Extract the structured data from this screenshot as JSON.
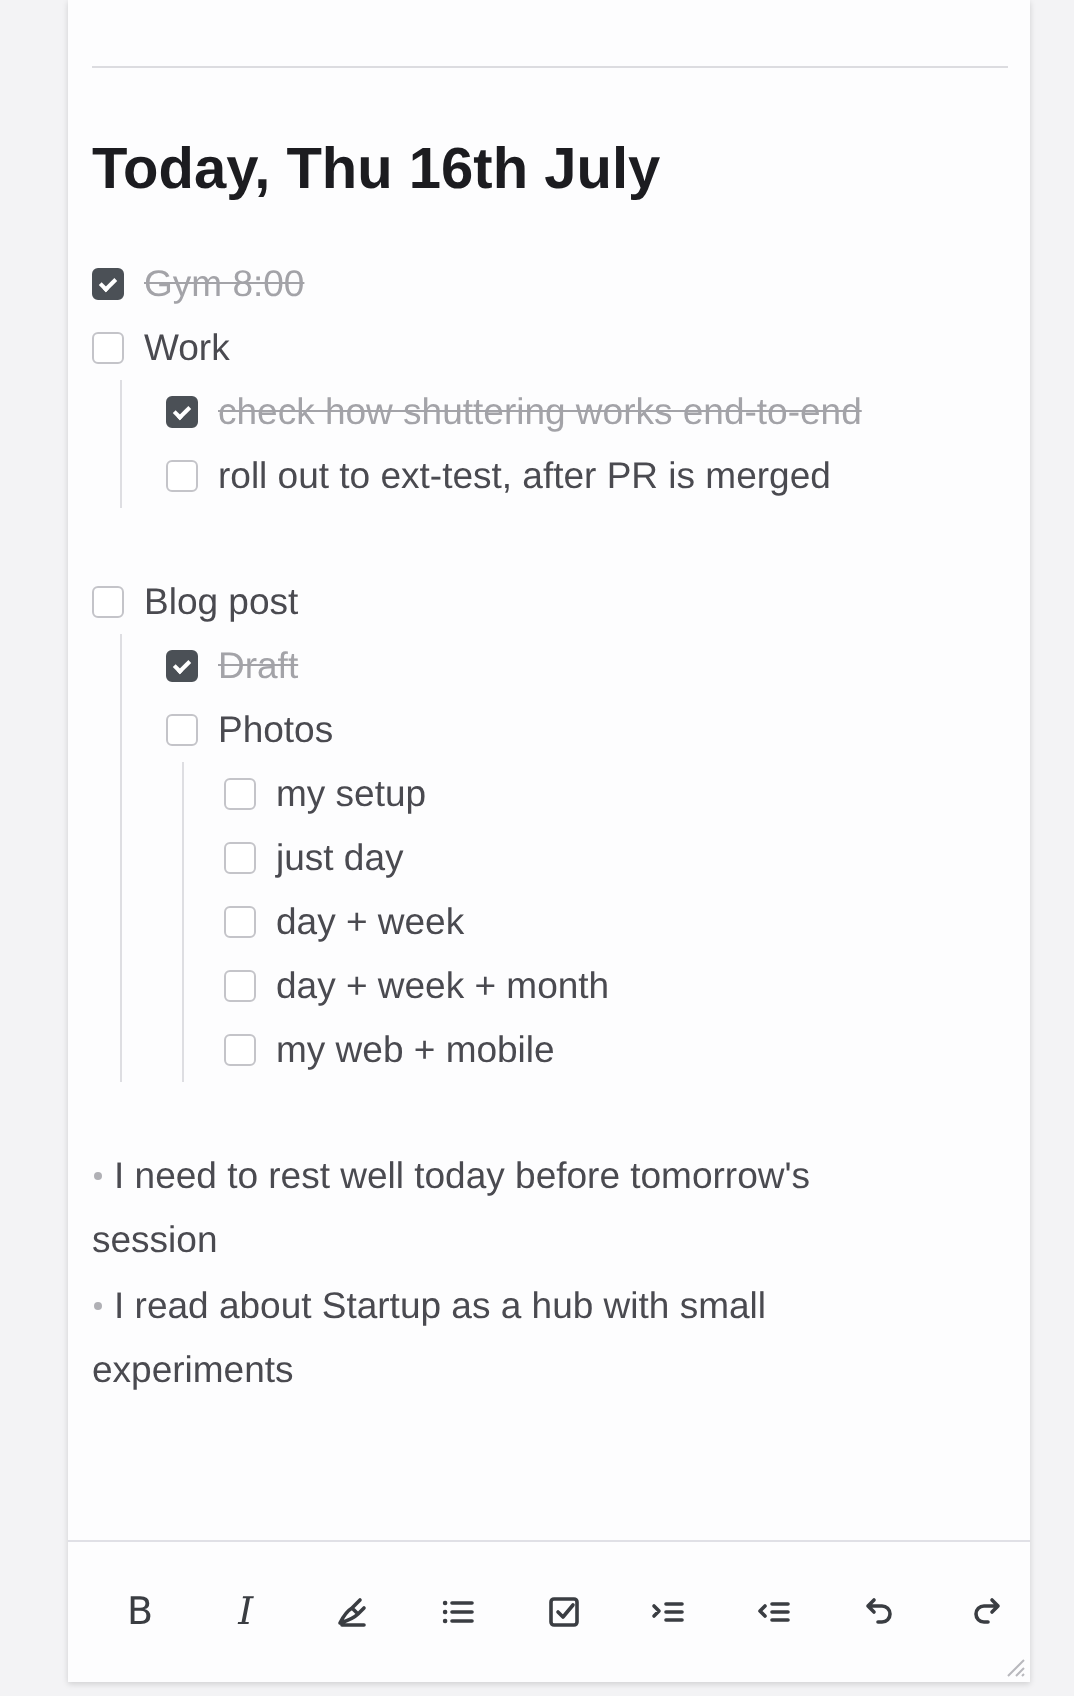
{
  "heading": "Today, Thu 16th July",
  "todo_groups": [
    [
      {
        "text": "Gym 8:00",
        "checked": true
      },
      {
        "text": "Work",
        "checked": false,
        "children": [
          {
            "text": "check how shuttering works end-to-end",
            "checked": true
          },
          {
            "text": "roll out to ext-test, after PR is merged",
            "checked": false
          }
        ]
      }
    ],
    [
      {
        "text": "Blog post",
        "checked": false,
        "children": [
          {
            "text": "Draft",
            "checked": true
          },
          {
            "text": "Photos",
            "checked": false,
            "children": [
              {
                "text": "my setup",
                "checked": false
              },
              {
                "text": "just day",
                "checked": false
              },
              {
                "text": "day + week",
                "checked": false
              },
              {
                "text": "day + week + month",
                "checked": false
              },
              {
                "text": "my web + mobile",
                "checked": false
              }
            ]
          }
        ]
      }
    ]
  ],
  "notes": [
    "I need to rest well today before tomorrow's session",
    "I read about Startup as a hub with small experiments"
  ],
  "toolbar": [
    {
      "kind": "bold",
      "label": "B"
    },
    {
      "kind": "italic",
      "label": "I"
    },
    {
      "kind": "highlight"
    },
    {
      "kind": "bullet-list"
    },
    {
      "kind": "checklist"
    },
    {
      "kind": "indent"
    },
    {
      "kind": "outdent"
    },
    {
      "kind": "undo"
    },
    {
      "kind": "redo"
    }
  ]
}
